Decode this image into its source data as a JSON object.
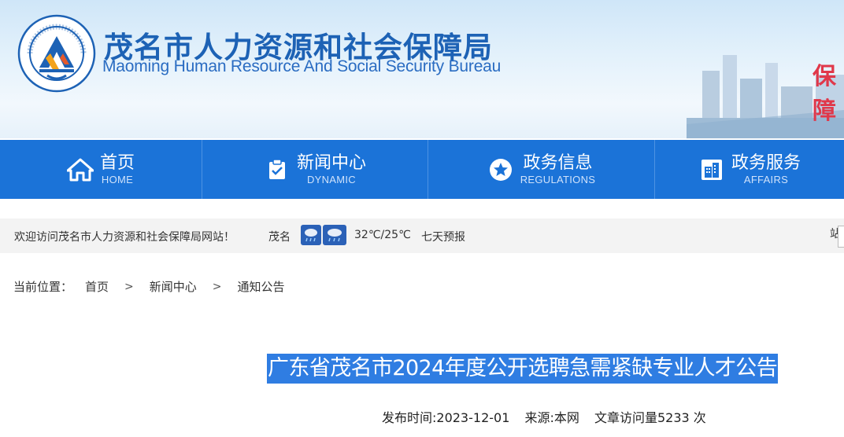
{
  "header": {
    "title_cn": "茂名市人力资源和社会保障局",
    "title_en": "Maoming Human Resource And Social Security Bureau",
    "slogan_partial": "保障",
    "logo_ring_text": "茂名市人力资源和社会保障局"
  },
  "nav": {
    "items": [
      {
        "cn": "首页",
        "en": "HOME",
        "icon": "home-icon"
      },
      {
        "cn": "新闻中心",
        "en": "DYNAMIC",
        "icon": "clipboard-check-icon"
      },
      {
        "cn": "政务信息",
        "en": "REGULATIONS",
        "icon": "star-icon"
      },
      {
        "cn": "政务服务",
        "en": "AFFAIRS",
        "icon": "building-icon"
      }
    ]
  },
  "welcome": {
    "message": "欢迎访问茂名市人力资源和社会保障局网站！",
    "city": "茂名",
    "temperature": "32℃/25℃",
    "forecast_link": "七天预报",
    "right_partial": "站"
  },
  "breadcrumb": {
    "label": "当前位置：",
    "items": [
      "首页",
      "新闻中心",
      "通知公告"
    ]
  },
  "article": {
    "title": "广东省茂名市2024年度公开选聘急需紧缺专业人才公告",
    "publish_time": "发布时间:2023-12-01",
    "source": "来源:本网",
    "views": "文章访问量5233 次"
  },
  "colors": {
    "nav_bg": "#1b73d8",
    "title_cn": "#1d62b5",
    "highlight": "#2f7de2"
  }
}
